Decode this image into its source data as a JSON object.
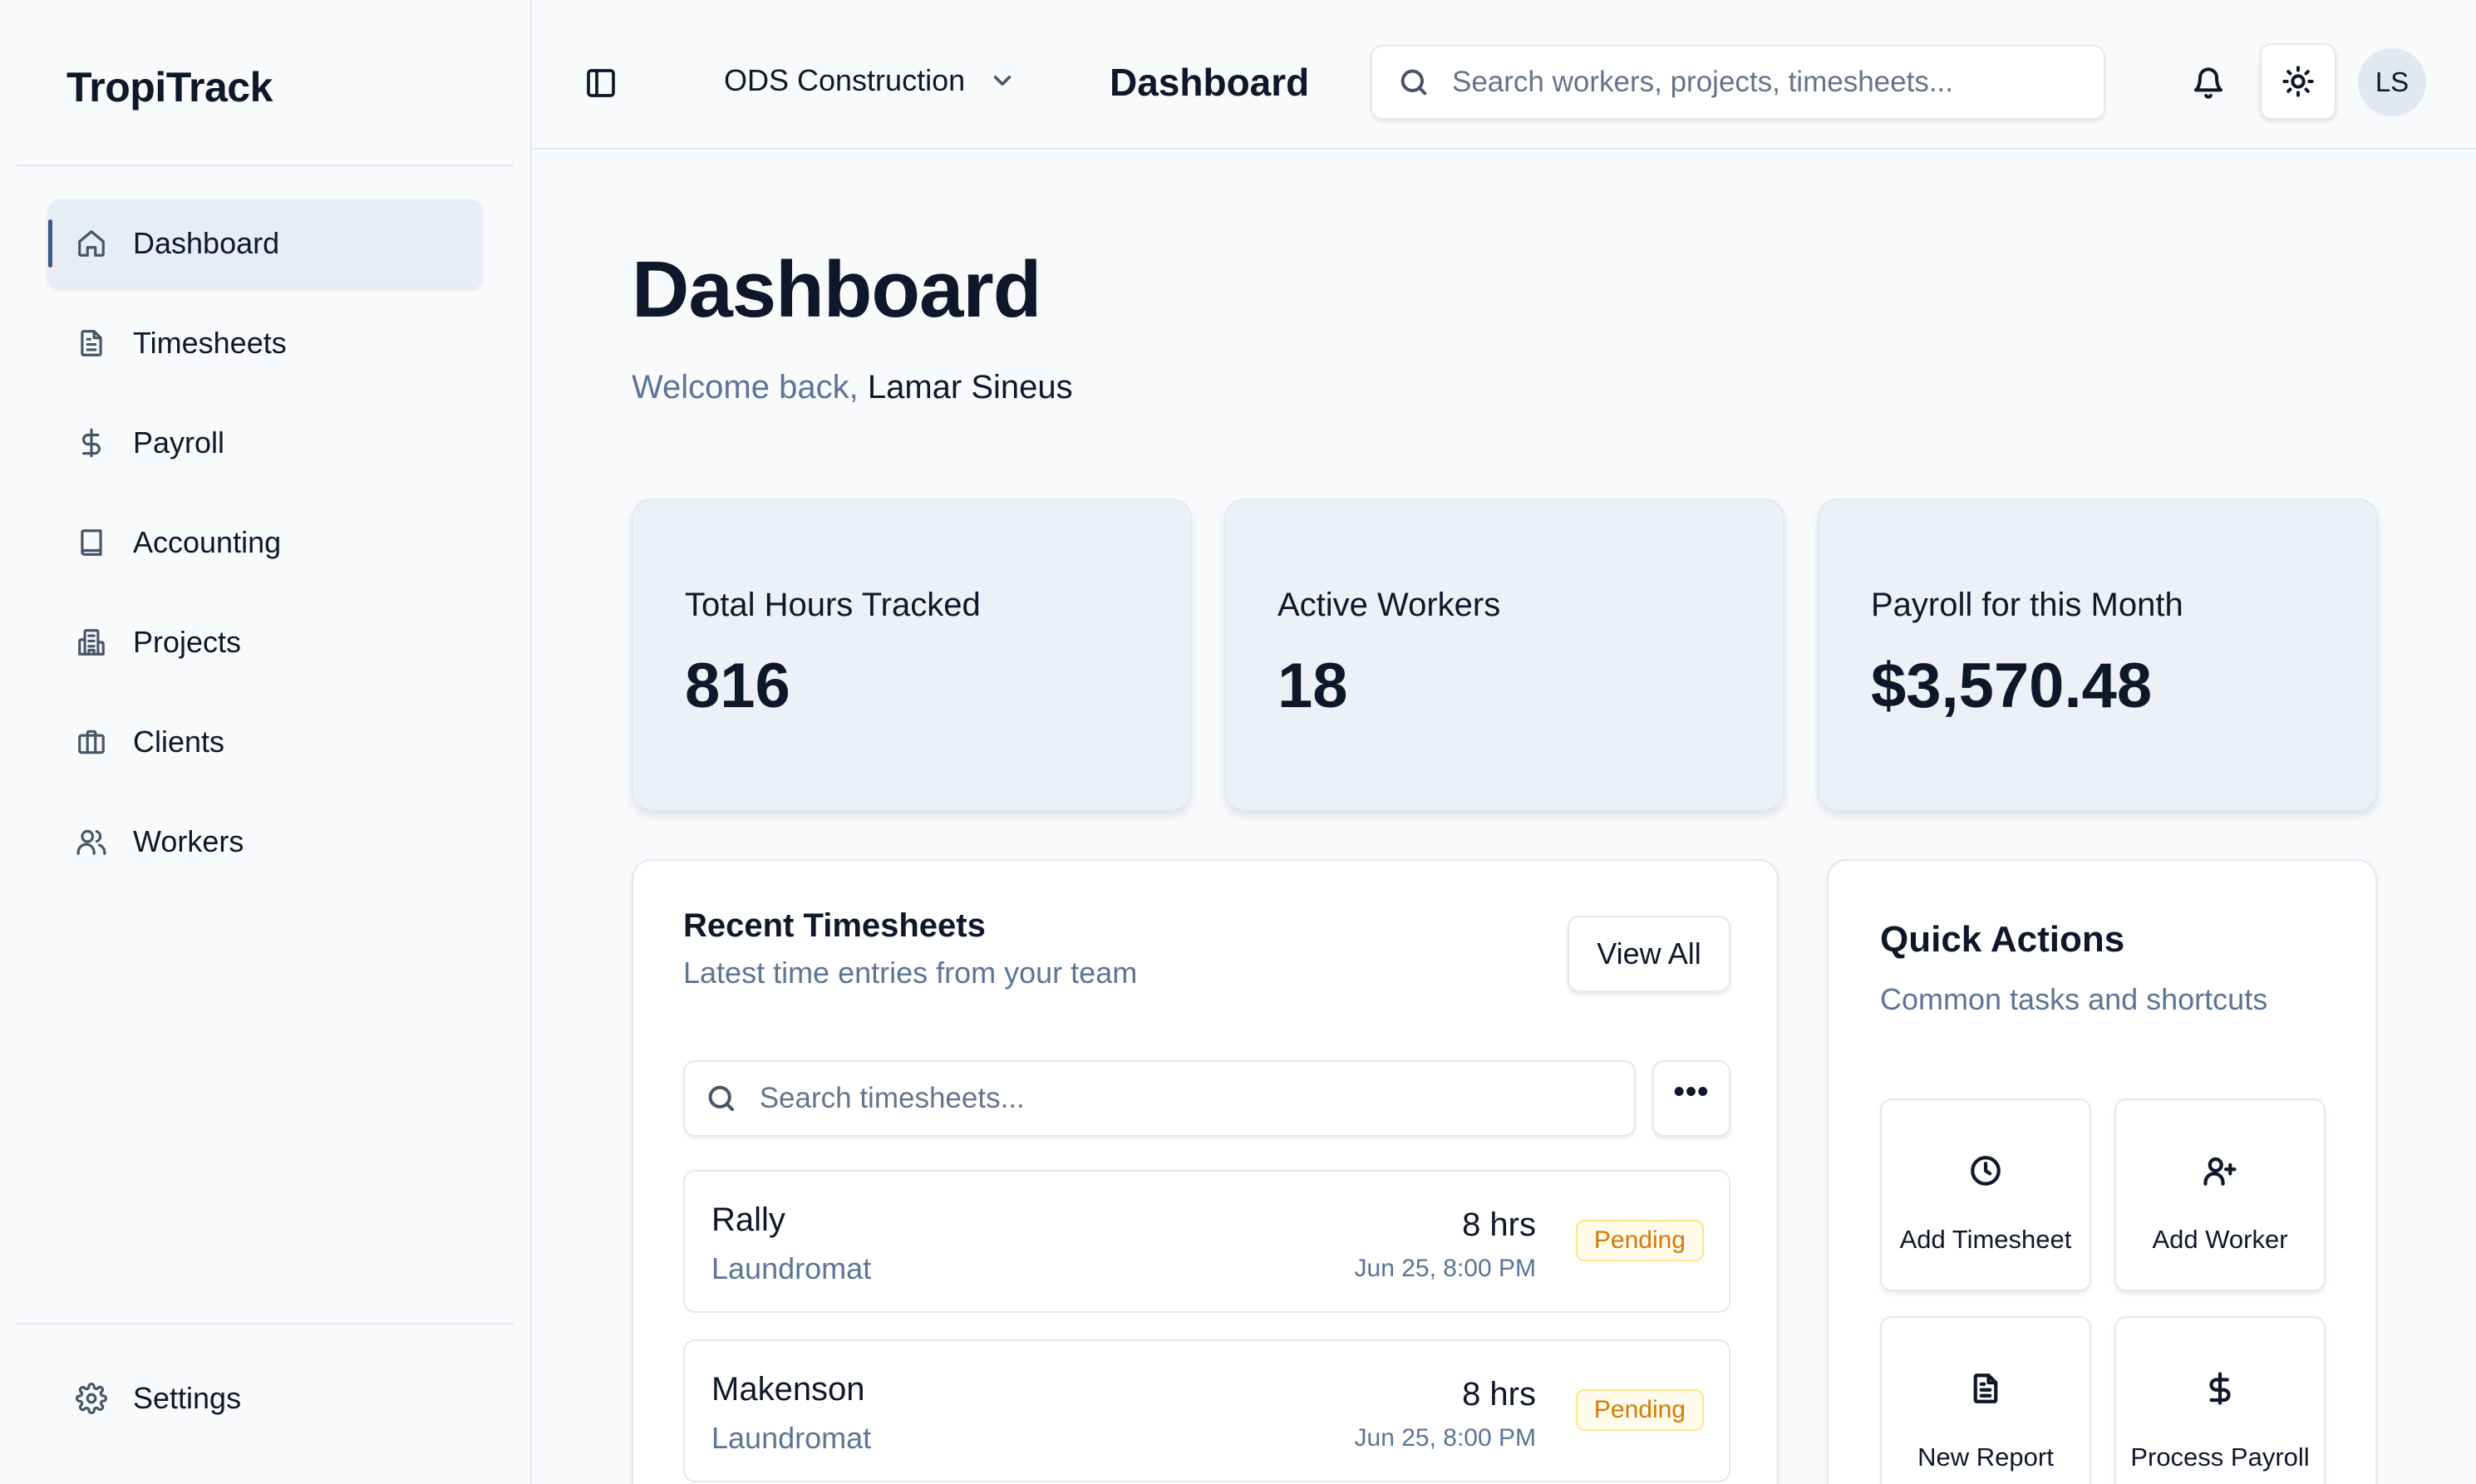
{
  "brand": "TropiTrack",
  "sidebar": {
    "items": [
      {
        "label": "Dashboard",
        "icon": "home-icon",
        "active": true
      },
      {
        "label": "Timesheets",
        "icon": "document-icon"
      },
      {
        "label": "Payroll",
        "icon": "dollar-icon"
      },
      {
        "label": "Accounting",
        "icon": "book-icon"
      },
      {
        "label": "Projects",
        "icon": "building-icon"
      },
      {
        "label": "Clients",
        "icon": "briefcase-icon"
      },
      {
        "label": "Workers",
        "icon": "users-icon"
      }
    ],
    "settings": {
      "label": "Settings",
      "icon": "gear-icon"
    }
  },
  "header": {
    "org": "ODS Construction",
    "title": "Dashboard",
    "search_placeholder": "Search workers, projects, timesheets...",
    "avatar_initials": "LS"
  },
  "main": {
    "title": "Dashboard",
    "welcome_prefix": "Welcome back,",
    "user_name": "Lamar Sineus",
    "stats": [
      {
        "label": "Total Hours Tracked",
        "value": "816"
      },
      {
        "label": "Active Workers",
        "value": "18"
      },
      {
        "label": "Payroll for this Month",
        "value": "$3,570.48"
      }
    ]
  },
  "recent_timesheets": {
    "title": "Recent Timesheets",
    "subtitle": "Latest time entries from your team",
    "view_all": "View All",
    "search_placeholder": "Search timesheets...",
    "more": "•••",
    "rows": [
      {
        "name": "Rally",
        "client": "Laundromat",
        "hours": "8 hrs",
        "time": "Jun 25, 8:00 PM",
        "status": "Pending"
      },
      {
        "name": "Makenson",
        "client": "Laundromat",
        "hours": "8 hrs",
        "time": "Jun 25, 8:00 PM",
        "status": "Pending"
      }
    ]
  },
  "quick_actions": {
    "title": "Quick Actions",
    "subtitle": "Common tasks and shortcuts",
    "buttons": [
      {
        "label": "Add Timesheet",
        "icon": "clock-icon"
      },
      {
        "label": "Add Worker",
        "icon": "user-plus-icon"
      },
      {
        "label": "New Report",
        "icon": "file-text-icon"
      },
      {
        "label": "Process Payroll",
        "icon": "dollar-icon"
      }
    ]
  },
  "colors": {
    "accent": "#3b5b86",
    "muted_text": "#5b7597",
    "pending": "#d97706"
  }
}
